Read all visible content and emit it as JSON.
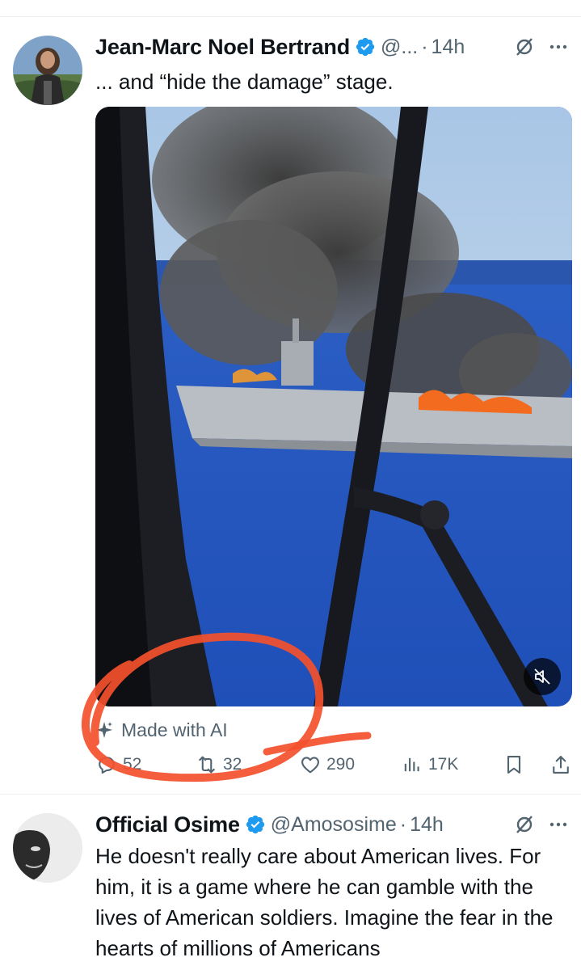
{
  "tweets": [
    {
      "author": "Jean-Marc Noel Bertrand",
      "handle": "@...",
      "separator": "·",
      "time": "14h",
      "text": "... and “hide the damage” stage.",
      "ai_label": "Made with AI",
      "stats": {
        "replies": "52",
        "reposts": "32",
        "likes": "290",
        "views": "17K"
      },
      "icons": [
        "verified-icon",
        "grok-icon",
        "more-icon",
        "mute-icon",
        "sparkle-icon",
        "reply-icon",
        "repost-icon",
        "like-icon",
        "views-icon",
        "bookmark-icon",
        "share-icon"
      ]
    },
    {
      "author": "Official Osime",
      "handle": "@Amososime",
      "separator": "·",
      "time": "14h",
      "text": "He doesn't really care about American lives. For him, it is a game where he can gamble with the lives of American soldiers. Imagine the fear in the hearts of millions of Americans",
      "icons": [
        "verified-icon",
        "grok-icon",
        "more-icon"
      ]
    }
  ],
  "colors": {
    "verified": "#1d9bf0",
    "secondary_text": "#536471",
    "annotation": "#f3502c"
  }
}
